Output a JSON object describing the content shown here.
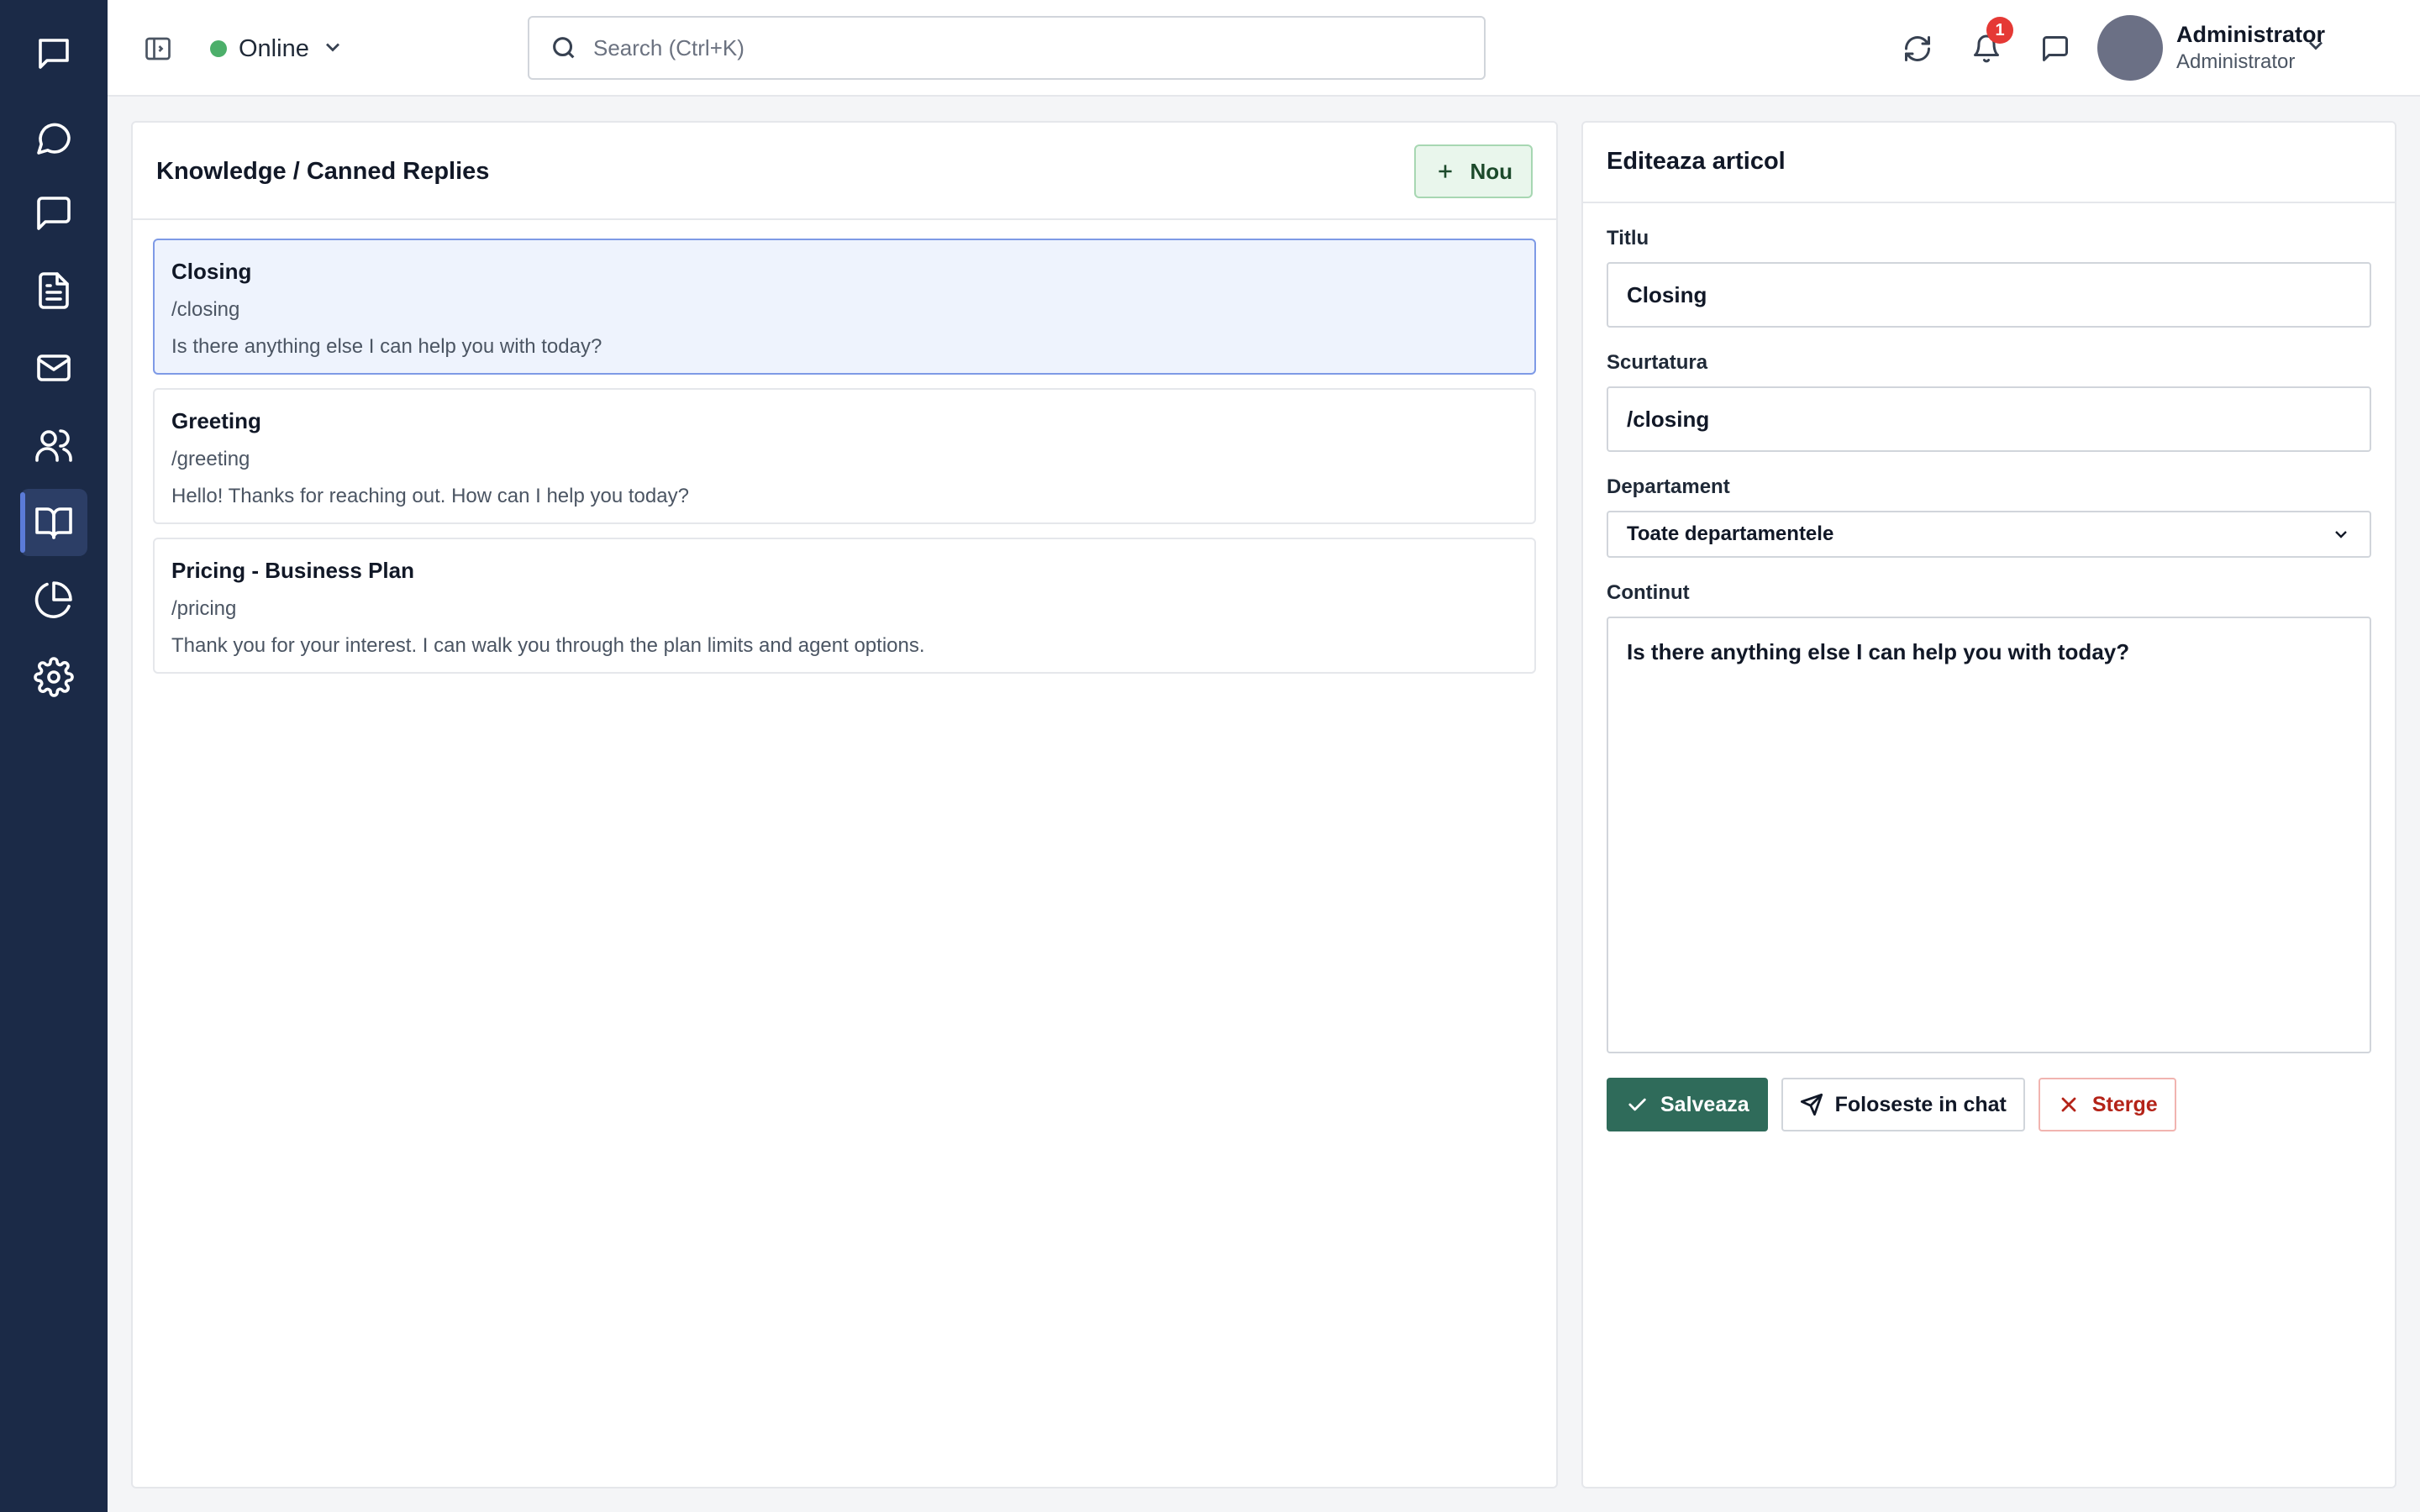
{
  "nav": {
    "items": [
      {
        "name": "chats",
        "icon": "chat-square-icon"
      },
      {
        "name": "conversations",
        "icon": "chat-bubble-icon"
      },
      {
        "name": "messages",
        "icon": "message-square-icon"
      },
      {
        "name": "documents",
        "icon": "document-icon"
      },
      {
        "name": "email",
        "icon": "mail-icon"
      },
      {
        "name": "contacts",
        "icon": "users-icon"
      },
      {
        "name": "knowledge",
        "icon": "book-open-icon",
        "active": true
      },
      {
        "name": "reports",
        "icon": "pie-chart-icon"
      },
      {
        "name": "settings",
        "icon": "gear-icon"
      }
    ],
    "background": "#1b2a47"
  },
  "topbar": {
    "status": "Online",
    "status_color": "#4caf6a",
    "search_placeholder": "Search (Ctrl+K)",
    "notifications_count": "1",
    "user_name": "Administrator",
    "user_role": "Administrator"
  },
  "list_panel": {
    "title": "Knowledge / Canned Replies",
    "new_button": "Nou",
    "replies": [
      {
        "title": "Closing",
        "shortcut": "/closing",
        "body": "Is there anything else I can help you with today?",
        "selected": true
      },
      {
        "title": "Greeting",
        "shortcut": "/greeting",
        "body": "Hello! Thanks for reaching out. How can I help you today?"
      },
      {
        "title": "Pricing - Business Plan",
        "shortcut": "/pricing",
        "body": "Thank you for your interest. I can walk you through the plan limits and agent options."
      }
    ]
  },
  "editor": {
    "title": "Editeaza articol",
    "title_label": "Titlu",
    "title_value": "Closing",
    "shortcut_label": "Scurtatura",
    "shortcut_value": "/closing",
    "department_label": "Departament",
    "department_value": "Toate departamentele",
    "content_label": "Continut",
    "content_value": "Is there anything else I can help you with today?",
    "save_button": "Salveaza",
    "use_button": "Foloseste in chat",
    "delete_button": "Sterge",
    "save_color": "#2f6b5a",
    "delete_color": "#b42318"
  }
}
